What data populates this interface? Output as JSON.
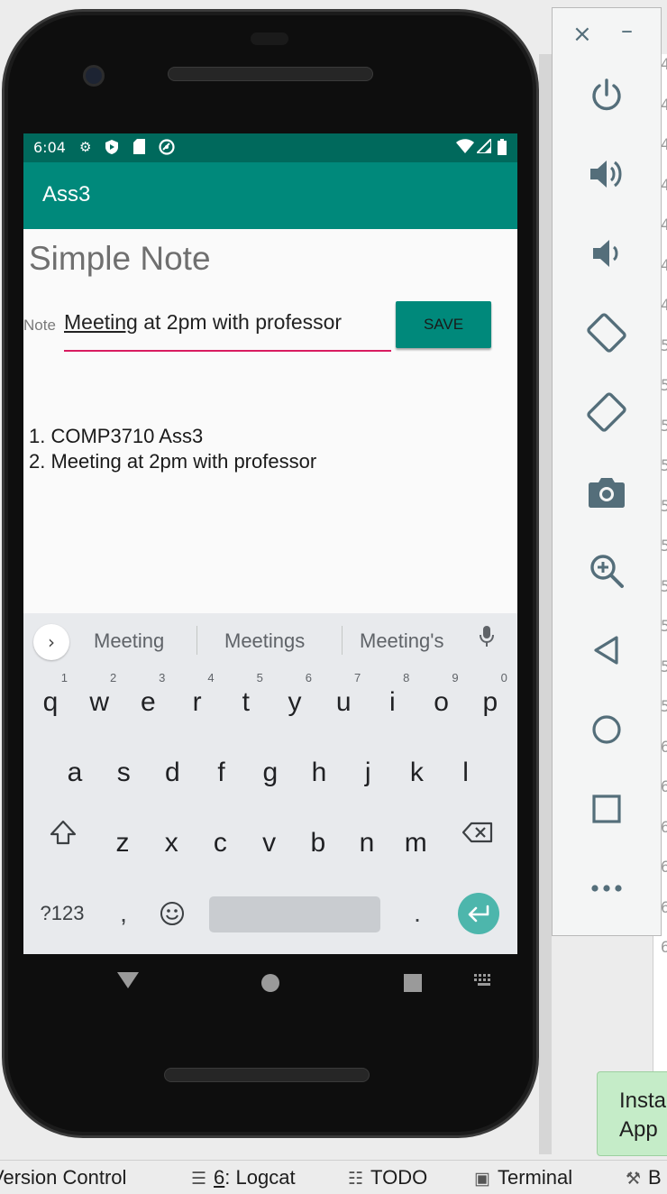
{
  "colors": {
    "status_bar": "#00695c",
    "app_bar": "#00897b",
    "input_underline": "#d81b60",
    "save_button": "#00897b",
    "enter_key": "#4db6ac",
    "emulator_icon": "#546e7a"
  },
  "status_bar": {
    "time": "6:04",
    "icons": [
      "settings-icon",
      "shield-icon",
      "sd-card-icon",
      "sync-icon",
      "wifi-icon",
      "signal-icon",
      "battery-icon"
    ]
  },
  "app": {
    "title": "Ass3",
    "page_title": "Simple Note",
    "note_label": "Note",
    "note_value_underlined": "Meeting",
    "note_value_rest": " at 2pm with professor",
    "save_label": "SAVE",
    "notes": [
      "1. COMP3710 Ass3",
      "2. Meeting at 2pm with professor"
    ]
  },
  "keyboard": {
    "suggestions": [
      "Meeting",
      "Meetings",
      "Meeting's"
    ],
    "row1": [
      "q",
      "w",
      "e",
      "r",
      "t",
      "y",
      "u",
      "i",
      "o",
      "p"
    ],
    "row1_hints": [
      "1",
      "2",
      "3",
      "4",
      "5",
      "6",
      "7",
      "8",
      "9",
      "0"
    ],
    "row2": [
      "a",
      "s",
      "d",
      "f",
      "g",
      "h",
      "j",
      "k",
      "l"
    ],
    "row3": [
      "z",
      "x",
      "c",
      "v",
      "b",
      "n",
      "m"
    ],
    "symbols_label": "?123",
    "comma": ",",
    "period": "."
  },
  "emulator_panel": {
    "buttons": [
      "power-icon",
      "volume-up-icon",
      "volume-down-icon",
      "rotate-left-icon",
      "rotate-right-icon",
      "camera-icon",
      "zoom-icon",
      "back-icon",
      "home-icon",
      "overview-icon",
      "more-icon"
    ]
  },
  "install_toast": {
    "line1": "Insta",
    "line2": "App"
  },
  "ide_toolbar": {
    "version_control": "Version Control",
    "logcat_num": "6",
    "logcat_label": ": Logcat",
    "todo": "TODO",
    "terminal": "Terminal",
    "build": "B"
  },
  "editor_line_digits": [
    "4",
    "4",
    "4",
    "4",
    "4",
    "4",
    "4",
    "5",
    "5",
    "5",
    "5",
    "5",
    "5",
    "5",
    "5",
    "5",
    "5",
    "6",
    "6",
    "6",
    "6",
    "6",
    "6"
  ]
}
